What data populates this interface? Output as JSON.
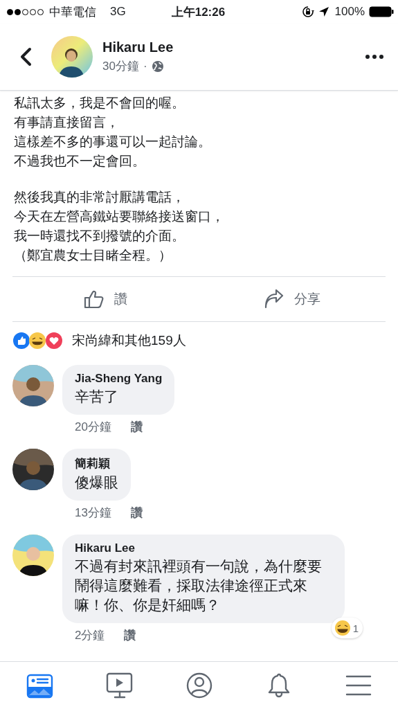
{
  "status_bar": {
    "carrier": "中華電信",
    "network": "3G",
    "time": "上午12:26",
    "battery": "100%"
  },
  "header": {
    "author": "Hikaru Lee",
    "time": "30分鐘",
    "separator": "·"
  },
  "post": {
    "paragraphs": [
      [
        "私訊太多，我是不會回的喔。",
        "有事請直接留言，",
        "這樣差不多的事還可以一起討論。",
        "不過我也不一定會回。"
      ],
      [
        "然後我真的非常討厭講電話，",
        "今天在左營高鐵站要聯絡接送窗口，",
        "我一時還找不到撥號的介面。",
        "（鄭宜農女士目睹全程。）"
      ]
    ]
  },
  "actions": [
    {
      "kind": "like",
      "label": "讚"
    },
    {
      "kind": "share",
      "label": "分享"
    }
  ],
  "reactions": {
    "summary": "宋尚緯和其他159人"
  },
  "comments": [
    {
      "author": "Jia-Sheng Yang",
      "text": "辛苦了",
      "time": "20分鐘",
      "like": "讚"
    },
    {
      "author": "簡莉穎",
      "text": "傻爆眼",
      "time": "13分鐘",
      "like": "讚"
    },
    {
      "author": "Hikaru Lee",
      "text": "不過有封來訊裡頭有一句說，為什麼要鬧得這麼難看，採取法律途徑正式來嘛！你、你是奸細嗎？",
      "time": "2分鐘",
      "like": "讚",
      "reaction_count": "1"
    }
  ],
  "nav": [
    {
      "kind": "news",
      "selected": true
    },
    {
      "kind": "video",
      "selected": false
    },
    {
      "kind": "profile",
      "selected": false
    },
    {
      "kind": "bell",
      "selected": false
    },
    {
      "kind": "menu",
      "selected": false
    }
  ]
}
